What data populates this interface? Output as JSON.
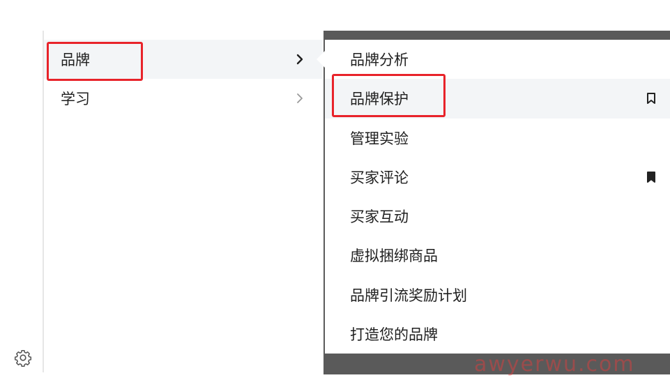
{
  "menu": {
    "items": [
      {
        "label": "品牌",
        "active": true
      },
      {
        "label": "学习",
        "active": false
      }
    ]
  },
  "submenu": {
    "items": [
      {
        "label": "品牌分析",
        "bookmark": "none"
      },
      {
        "label": "品牌保护",
        "bookmark": "outline"
      },
      {
        "label": "管理实验",
        "bookmark": "none"
      },
      {
        "label": "买家评论",
        "bookmark": "filled"
      },
      {
        "label": "买家互动",
        "bookmark": "none"
      },
      {
        "label": "虚拟捆绑商品",
        "bookmark": "none"
      },
      {
        "label": "品牌引流奖励计划",
        "bookmark": "none"
      },
      {
        "label": "打造您的品牌",
        "bookmark": "none"
      }
    ]
  },
  "icons": {
    "settings": "gear-icon",
    "chevron": "chevron-right-icon",
    "bookmark_outline": "bookmark-outline-icon",
    "bookmark_filled": "bookmark-filled-icon"
  },
  "watermark": "awyerwu.com",
  "colors": {
    "highlight": "#e8232a",
    "active_bg": "#f3f5f7",
    "text": "#1f1f1f"
  }
}
